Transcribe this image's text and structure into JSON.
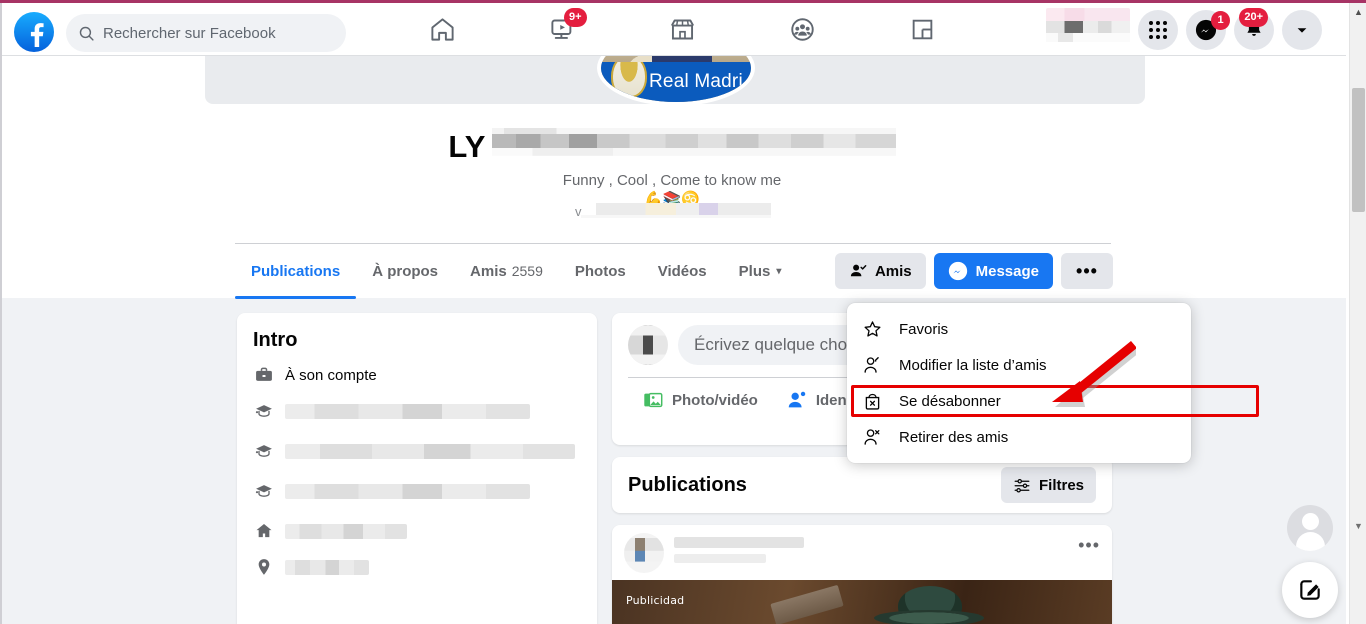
{
  "browser": {
    "scrollbar": {
      "up_arrow": "▲",
      "down_arrow": "▼"
    }
  },
  "topbar": {
    "logo": "facebook-logo",
    "search": {
      "placeholder": "Rechercher sur Facebook",
      "icon": "search-icon"
    },
    "nav": [
      {
        "name": "home",
        "icon": "home-icon",
        "badge": ""
      },
      {
        "name": "video",
        "icon": "video-icon",
        "badge": "9+"
      },
      {
        "name": "marketplace",
        "icon": "marketplace-icon",
        "badge": ""
      },
      {
        "name": "groups",
        "icon": "groups-icon",
        "badge": ""
      },
      {
        "name": "gaming",
        "icon": "gaming-icon",
        "badge": ""
      }
    ],
    "right": {
      "profile_blurred": "blurred-profile-name",
      "menu_icon": "grid-menu-icon",
      "messenger_icon": "messenger-icon",
      "messenger_badge": "1",
      "notifications_icon": "bell-icon",
      "notifications_badge": "20+",
      "account_icon": "chevron-down-icon"
    }
  },
  "profile": {
    "picture_banner_text": "Real Madri",
    "name_visible": "LY",
    "bio": "Funny , Cool , Come to know me",
    "bio_emoji": "💪📚♋",
    "bio_extra_prefix": "v"
  },
  "tabs": [
    {
      "label": "Publications",
      "count": "",
      "active": true
    },
    {
      "label": "À propos",
      "count": "",
      "active": false
    },
    {
      "label": "Amis",
      "count": "2559",
      "active": false
    },
    {
      "label": "Photos",
      "count": "",
      "active": false
    },
    {
      "label": "Vidéos",
      "count": "",
      "active": false
    },
    {
      "label": "Plus",
      "count": "",
      "active": false,
      "caret": "▾"
    }
  ],
  "actions": {
    "friends_label": "Amis",
    "friends_icon": "friend-check-icon",
    "message_label": "Message",
    "message_icon": "messenger-icon",
    "more_label": "•••"
  },
  "dropdown": {
    "items": [
      {
        "label": "Favoris",
        "icon": "star-icon",
        "highlighted": false
      },
      {
        "label": "Modifier la liste d’amis",
        "icon": "edit-friend-icon",
        "highlighted": false
      },
      {
        "label": "Se désabonner",
        "icon": "unfollow-icon",
        "highlighted": true
      },
      {
        "label": "Retirer des amis",
        "icon": "remove-friend-icon",
        "highlighted": false
      }
    ],
    "highlight_color": "#e60000",
    "arrow_color": "#e60000"
  },
  "intro": {
    "title": "Intro",
    "rows": [
      {
        "icon": "briefcase-icon",
        "text": "À son compte",
        "blurred": false
      },
      {
        "icon": "graduation-icon",
        "text": "",
        "blurred": true
      },
      {
        "icon": "graduation-icon",
        "text": "",
        "blurred": true
      },
      {
        "icon": "graduation-icon",
        "text": "",
        "blurred": true
      },
      {
        "icon": "home-filled-icon",
        "text": "",
        "blurred": true
      },
      {
        "icon": "location-pin-icon",
        "text": "",
        "blurred": true
      }
    ]
  },
  "composer": {
    "placeholder": "Écrivez quelque chos",
    "actions": [
      {
        "label": "Photo/vidéo",
        "icon": "photo-video-icon"
      },
      {
        "label": "Iden",
        "icon": "tag-person-icon"
      }
    ]
  },
  "publications": {
    "title": "Publications",
    "filter_label": "Filtres",
    "filter_icon": "sliders-icon"
  },
  "post": {
    "menu": "•••",
    "media_label": "Publicidad"
  },
  "floating": {
    "avatar_icon": "user-avatar-icon",
    "compose_icon": "compose-pencil-icon"
  },
  "colors": {
    "accent_blue": "#1877f2",
    "badge_red": "#e41e3f",
    "highlight_red": "#e60000",
    "page_gray": "#f0f2f5",
    "chrome_magenta": "#a73465"
  }
}
